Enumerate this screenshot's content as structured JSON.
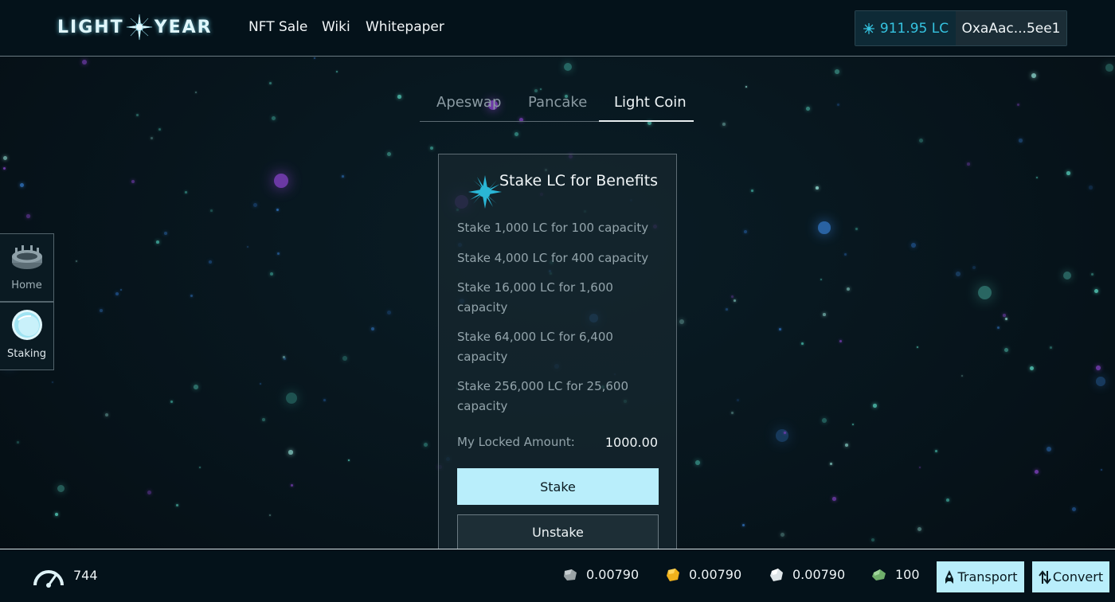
{
  "header": {
    "logo_left": "LIGHT",
    "logo_right": "YEAR",
    "nav": [
      {
        "label": "NFT Sale"
      },
      {
        "label": "Wiki"
      },
      {
        "label": "Whitepaper"
      }
    ],
    "balance": "911.95 LC",
    "address": "OxaAac...5ee1"
  },
  "tabs": [
    {
      "label": "Apeswap"
    },
    {
      "label": "Pancake"
    },
    {
      "label": "Light Coin",
      "active": true
    }
  ],
  "card": {
    "title": "Stake LC for Benefits",
    "tiers": [
      {
        "text": "Stake 1,000 LC for 100 capacity"
      },
      {
        "text": "Stake 4,000 LC for 400 capacity"
      },
      {
        "text": "Stake 16,000 LC for 1,600 capacity"
      },
      {
        "text": "Stake 64,000 LC for 6,400 capacity"
      },
      {
        "text": "Stake 256,000 LC for 25,600 capacity"
      }
    ],
    "locked_label": "My Locked Amount:",
    "locked_value": "1000.00",
    "stake_label": "Stake",
    "unstake_label": "Unstake"
  },
  "sidebar": {
    "items": [
      {
        "label": "Home",
        "icon": "arena-icon"
      },
      {
        "label": "Staking",
        "icon": "planet-icon"
      }
    ]
  },
  "footer": {
    "capacity": "744",
    "resources": [
      {
        "icon": "metal-ore-icon",
        "value": "0.00790",
        "color": "#9aa3a6"
      },
      {
        "icon": "gold-ore-icon",
        "value": "0.00790",
        "color": "#f0b21c"
      },
      {
        "icon": "crystal-ore-icon",
        "value": "0.00790",
        "color": "#dfe6e9"
      },
      {
        "icon": "green-ore-icon",
        "value": "100",
        "color": "#6fae6a"
      }
    ],
    "transport_label": "Transport",
    "convert_label": "Convert"
  },
  "colors": {
    "accent": "#35c3e0",
    "button_bg": "#b9eefb",
    "background": "#06141a"
  }
}
